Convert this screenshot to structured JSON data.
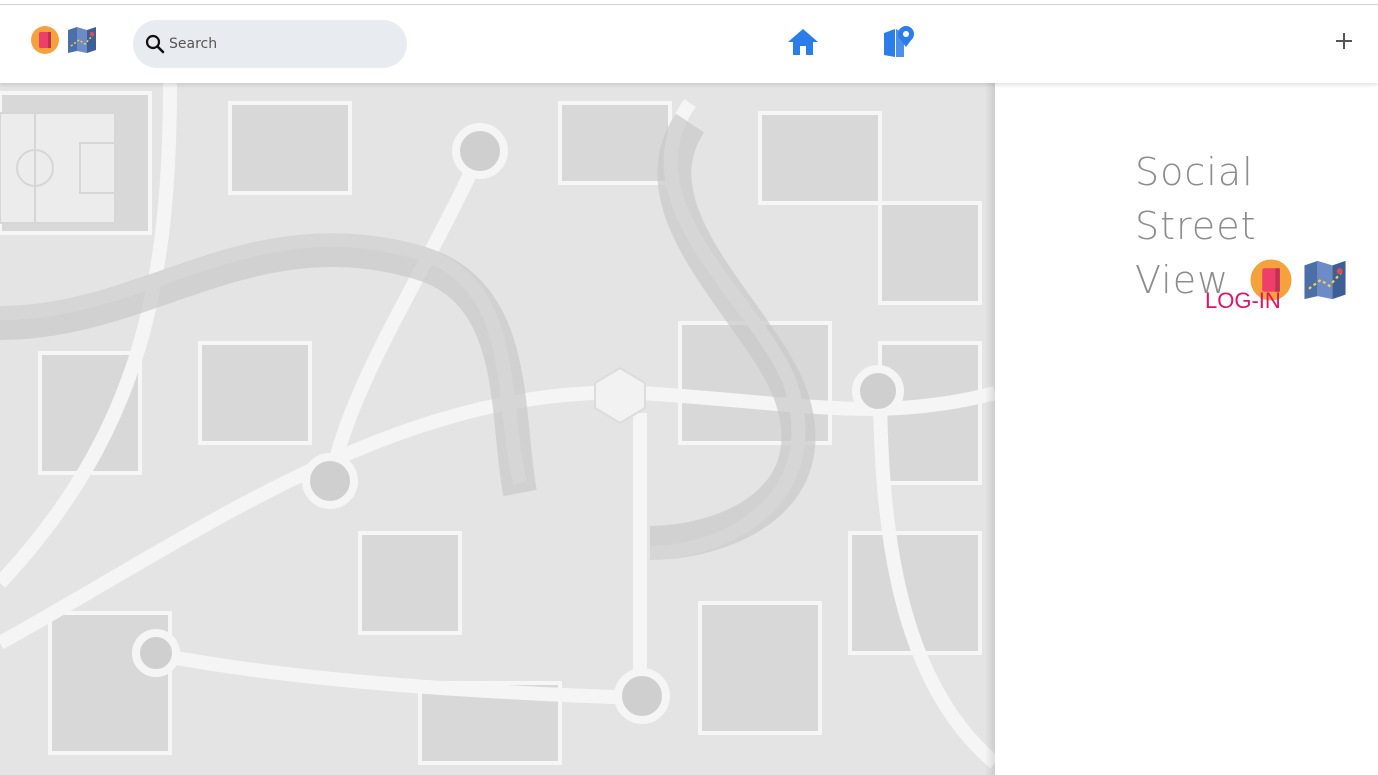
{
  "navbar": {
    "search_placeholder": "Search"
  },
  "icons": {
    "logo_book": "book-icon",
    "logo_map": "folded-map-icon",
    "search": "search-icon",
    "home": "home-icon",
    "explore": "explore-icon",
    "add": "plus-icon"
  },
  "colors": {
    "accent_blue": "#2b7de9",
    "login_pink": "#e2126b",
    "brand_gray": "#8c8c8c"
  },
  "panel": {
    "brand_line1": "Social Street",
    "brand_line2": "View",
    "login_label": "LOG-IN"
  }
}
